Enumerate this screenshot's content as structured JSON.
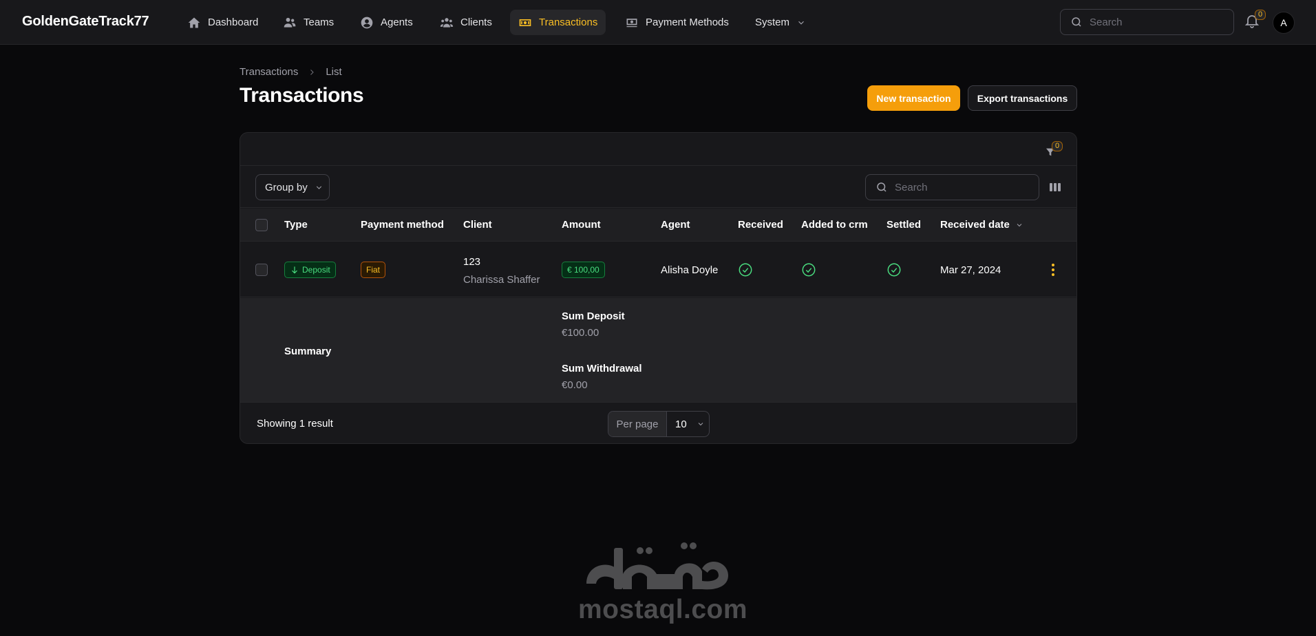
{
  "app": {
    "brand": "GoldenGateTrack77"
  },
  "nav": {
    "items": [
      {
        "label": "Dashboard",
        "icon": "home-icon"
      },
      {
        "label": "Teams",
        "icon": "users-group-icon"
      },
      {
        "label": "Agents",
        "icon": "user-circle-icon"
      },
      {
        "label": "Clients",
        "icon": "users-group-icon"
      },
      {
        "label": "Transactions",
        "icon": "banknote-icon",
        "active": true
      },
      {
        "label": "Payment Methods",
        "icon": "cash-icon"
      },
      {
        "label": "System",
        "icon": "chevron-down-icon"
      }
    ],
    "search_placeholder": "Search",
    "notifications_count": "0",
    "avatar_initial": "A"
  },
  "page": {
    "breadcrumb": [
      "Transactions",
      "List"
    ],
    "title": "Transactions",
    "new_button": "New transaction",
    "export_button": "Export transactions"
  },
  "table": {
    "filter_count": "0",
    "group_by_label": "Group by",
    "search_placeholder": "Search",
    "columns": [
      "Type",
      "Payment method",
      "Client",
      "Amount",
      "Agent",
      "Received",
      "Added to crm",
      "Settled",
      "Received date"
    ],
    "sort_column": "Received date",
    "rows": [
      {
        "type": "Deposit",
        "payment_method": "Fiat",
        "client_id": "123",
        "client_name": "Charissa Shaffer",
        "amount": "€ 100,00",
        "agent": "Alisha Doyle",
        "received": true,
        "added_to_crm": true,
        "settled": true,
        "received_date": "Mar 27, 2024"
      }
    ],
    "summary": {
      "label": "Summary",
      "sum_deposit_label": "Sum Deposit",
      "sum_deposit_value": "€100.00",
      "sum_withdrawal_label": "Sum Withdrawal",
      "sum_withdrawal_value": "€0.00"
    },
    "footer": {
      "result_text": "Showing 1 result",
      "per_page_label": "Per page",
      "per_page_value": "10"
    }
  },
  "watermark": {
    "arabic": "مستقل",
    "latin": "mostaql.com"
  },
  "colors": {
    "accent": "#f59e0b",
    "success": "#4ade80",
    "background": "#09090b",
    "surface": "#18181b"
  }
}
